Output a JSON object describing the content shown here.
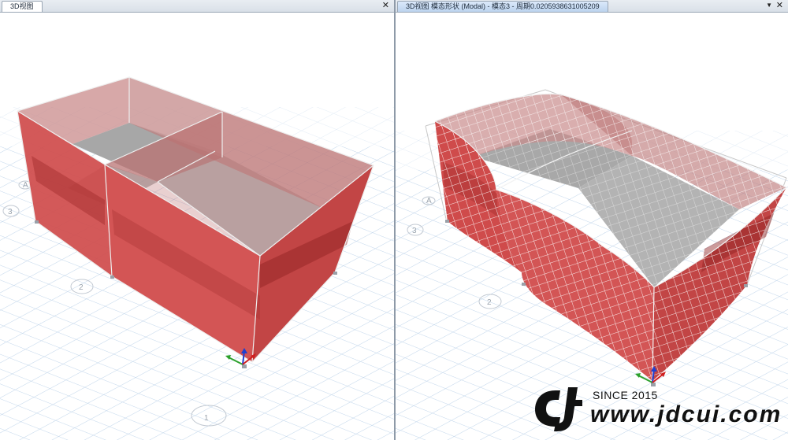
{
  "left_pane": {
    "tab_title": "3D视图",
    "close_glyph": "✕",
    "grid_labels": [
      "1",
      "2",
      "3",
      "A"
    ]
  },
  "right_pane": {
    "tab_title": "3D视图   模态形状 (Modal) - 模态3 - 周期0.0205938631005209",
    "arrow_glyph": "▼",
    "close_glyph": "✕",
    "grid_labels": [
      "2",
      "3",
      "A"
    ]
  },
  "watermark": {
    "since": "SINCE 2015",
    "url": "www.jdcui.com"
  },
  "colors": {
    "wall_red": "#cf4b4b",
    "grid_blue": "#b7cfe8",
    "edge": "#eeeeee",
    "tab_active": "#bcd3ee"
  },
  "icons": [
    "close-icon",
    "dropdown-arrow-icon",
    "axis-triad-icon",
    "jdcui-logo-icon"
  ]
}
